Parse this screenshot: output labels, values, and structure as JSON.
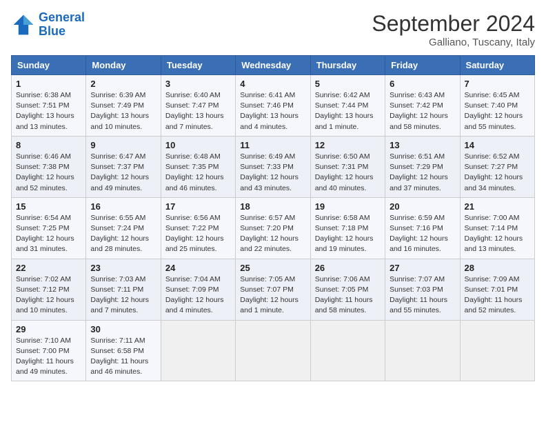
{
  "header": {
    "logo_general": "General",
    "logo_blue": "Blue",
    "month": "September 2024",
    "location": "Galliano, Tuscany, Italy"
  },
  "days_of_week": [
    "Sunday",
    "Monday",
    "Tuesday",
    "Wednesday",
    "Thursday",
    "Friday",
    "Saturday"
  ],
  "weeks": [
    [
      {
        "day": "1",
        "info": "Sunrise: 6:38 AM\nSunset: 7:51 PM\nDaylight: 13 hours\nand 13 minutes."
      },
      {
        "day": "2",
        "info": "Sunrise: 6:39 AM\nSunset: 7:49 PM\nDaylight: 13 hours\nand 10 minutes."
      },
      {
        "day": "3",
        "info": "Sunrise: 6:40 AM\nSunset: 7:47 PM\nDaylight: 13 hours\nand 7 minutes."
      },
      {
        "day": "4",
        "info": "Sunrise: 6:41 AM\nSunset: 7:46 PM\nDaylight: 13 hours\nand 4 minutes."
      },
      {
        "day": "5",
        "info": "Sunrise: 6:42 AM\nSunset: 7:44 PM\nDaylight: 13 hours\nand 1 minute."
      },
      {
        "day": "6",
        "info": "Sunrise: 6:43 AM\nSunset: 7:42 PM\nDaylight: 12 hours\nand 58 minutes."
      },
      {
        "day": "7",
        "info": "Sunrise: 6:45 AM\nSunset: 7:40 PM\nDaylight: 12 hours\nand 55 minutes."
      }
    ],
    [
      {
        "day": "8",
        "info": "Sunrise: 6:46 AM\nSunset: 7:38 PM\nDaylight: 12 hours\nand 52 minutes."
      },
      {
        "day": "9",
        "info": "Sunrise: 6:47 AM\nSunset: 7:37 PM\nDaylight: 12 hours\nand 49 minutes."
      },
      {
        "day": "10",
        "info": "Sunrise: 6:48 AM\nSunset: 7:35 PM\nDaylight: 12 hours\nand 46 minutes."
      },
      {
        "day": "11",
        "info": "Sunrise: 6:49 AM\nSunset: 7:33 PM\nDaylight: 12 hours\nand 43 minutes."
      },
      {
        "day": "12",
        "info": "Sunrise: 6:50 AM\nSunset: 7:31 PM\nDaylight: 12 hours\nand 40 minutes."
      },
      {
        "day": "13",
        "info": "Sunrise: 6:51 AM\nSunset: 7:29 PM\nDaylight: 12 hours\nand 37 minutes."
      },
      {
        "day": "14",
        "info": "Sunrise: 6:52 AM\nSunset: 7:27 PM\nDaylight: 12 hours\nand 34 minutes."
      }
    ],
    [
      {
        "day": "15",
        "info": "Sunrise: 6:54 AM\nSunset: 7:25 PM\nDaylight: 12 hours\nand 31 minutes."
      },
      {
        "day": "16",
        "info": "Sunrise: 6:55 AM\nSunset: 7:24 PM\nDaylight: 12 hours\nand 28 minutes."
      },
      {
        "day": "17",
        "info": "Sunrise: 6:56 AM\nSunset: 7:22 PM\nDaylight: 12 hours\nand 25 minutes."
      },
      {
        "day": "18",
        "info": "Sunrise: 6:57 AM\nSunset: 7:20 PM\nDaylight: 12 hours\nand 22 minutes."
      },
      {
        "day": "19",
        "info": "Sunrise: 6:58 AM\nSunset: 7:18 PM\nDaylight: 12 hours\nand 19 minutes."
      },
      {
        "day": "20",
        "info": "Sunrise: 6:59 AM\nSunset: 7:16 PM\nDaylight: 12 hours\nand 16 minutes."
      },
      {
        "day": "21",
        "info": "Sunrise: 7:00 AM\nSunset: 7:14 PM\nDaylight: 12 hours\nand 13 minutes."
      }
    ],
    [
      {
        "day": "22",
        "info": "Sunrise: 7:02 AM\nSunset: 7:12 PM\nDaylight: 12 hours\nand 10 minutes."
      },
      {
        "day": "23",
        "info": "Sunrise: 7:03 AM\nSunset: 7:11 PM\nDaylight: 12 hours\nand 7 minutes."
      },
      {
        "day": "24",
        "info": "Sunrise: 7:04 AM\nSunset: 7:09 PM\nDaylight: 12 hours\nand 4 minutes."
      },
      {
        "day": "25",
        "info": "Sunrise: 7:05 AM\nSunset: 7:07 PM\nDaylight: 12 hours\nand 1 minute."
      },
      {
        "day": "26",
        "info": "Sunrise: 7:06 AM\nSunset: 7:05 PM\nDaylight: 11 hours\nand 58 minutes."
      },
      {
        "day": "27",
        "info": "Sunrise: 7:07 AM\nSunset: 7:03 PM\nDaylight: 11 hours\nand 55 minutes."
      },
      {
        "day": "28",
        "info": "Sunrise: 7:09 AM\nSunset: 7:01 PM\nDaylight: 11 hours\nand 52 minutes."
      }
    ],
    [
      {
        "day": "29",
        "info": "Sunrise: 7:10 AM\nSunset: 7:00 PM\nDaylight: 11 hours\nand 49 minutes."
      },
      {
        "day": "30",
        "info": "Sunrise: 7:11 AM\nSunset: 6:58 PM\nDaylight: 11 hours\nand 46 minutes."
      },
      {
        "day": "",
        "info": ""
      },
      {
        "day": "",
        "info": ""
      },
      {
        "day": "",
        "info": ""
      },
      {
        "day": "",
        "info": ""
      },
      {
        "day": "",
        "info": ""
      }
    ]
  ]
}
